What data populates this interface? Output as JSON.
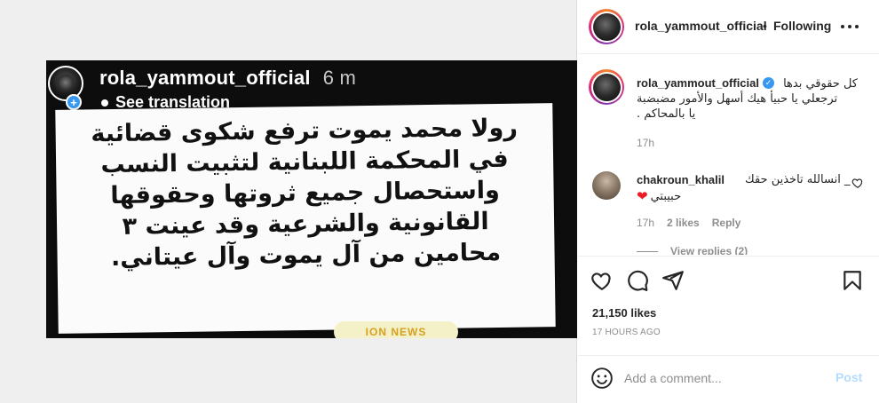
{
  "story": {
    "username": "rola_yammout_official",
    "time": "6 m",
    "see_translation": "See translation",
    "card_lines": [
      "رولا محمد يموت ترفع شكوى قضائية",
      "في المحكمة اللبنانية لتثبيت النسب",
      "واستحصال جميع ثروتها وحقوقها",
      "القانونية والشرعية وقد عينت ٣",
      "محامين من آل يموت وآل عيتاني."
    ],
    "sticker_text": "ION NEWS"
  },
  "header": {
    "username": "rola_yammout_official",
    "separator": "•",
    "follow_status": "Following"
  },
  "caption": {
    "username": "rola_yammout_official",
    "line1": "كل حقوقي بدها",
    "line2": "ترجعلي يا حبيأ هيك أسهل والأمور مضبضبة",
    "line3": ". يا بالمحاكم",
    "time": "17h"
  },
  "comment": {
    "username": "chakroun_khalil",
    "text1": "_ انسالله تاخذين حقك",
    "text2": "حبيبتي",
    "heart": "❤",
    "time": "17h",
    "likes": "2 likes",
    "reply": "Reply",
    "view_replies": "View replies (2)"
  },
  "actions": {
    "likes_count": "21,150 likes",
    "posted_ago": "17 HOURS AGO"
  },
  "comment_box": {
    "placeholder": "Add a comment...",
    "post_label": "Post"
  },
  "colors": {
    "accent": "#3897f0",
    "post_disabled": "#b3dbff",
    "muted": "#8e8e8e"
  }
}
